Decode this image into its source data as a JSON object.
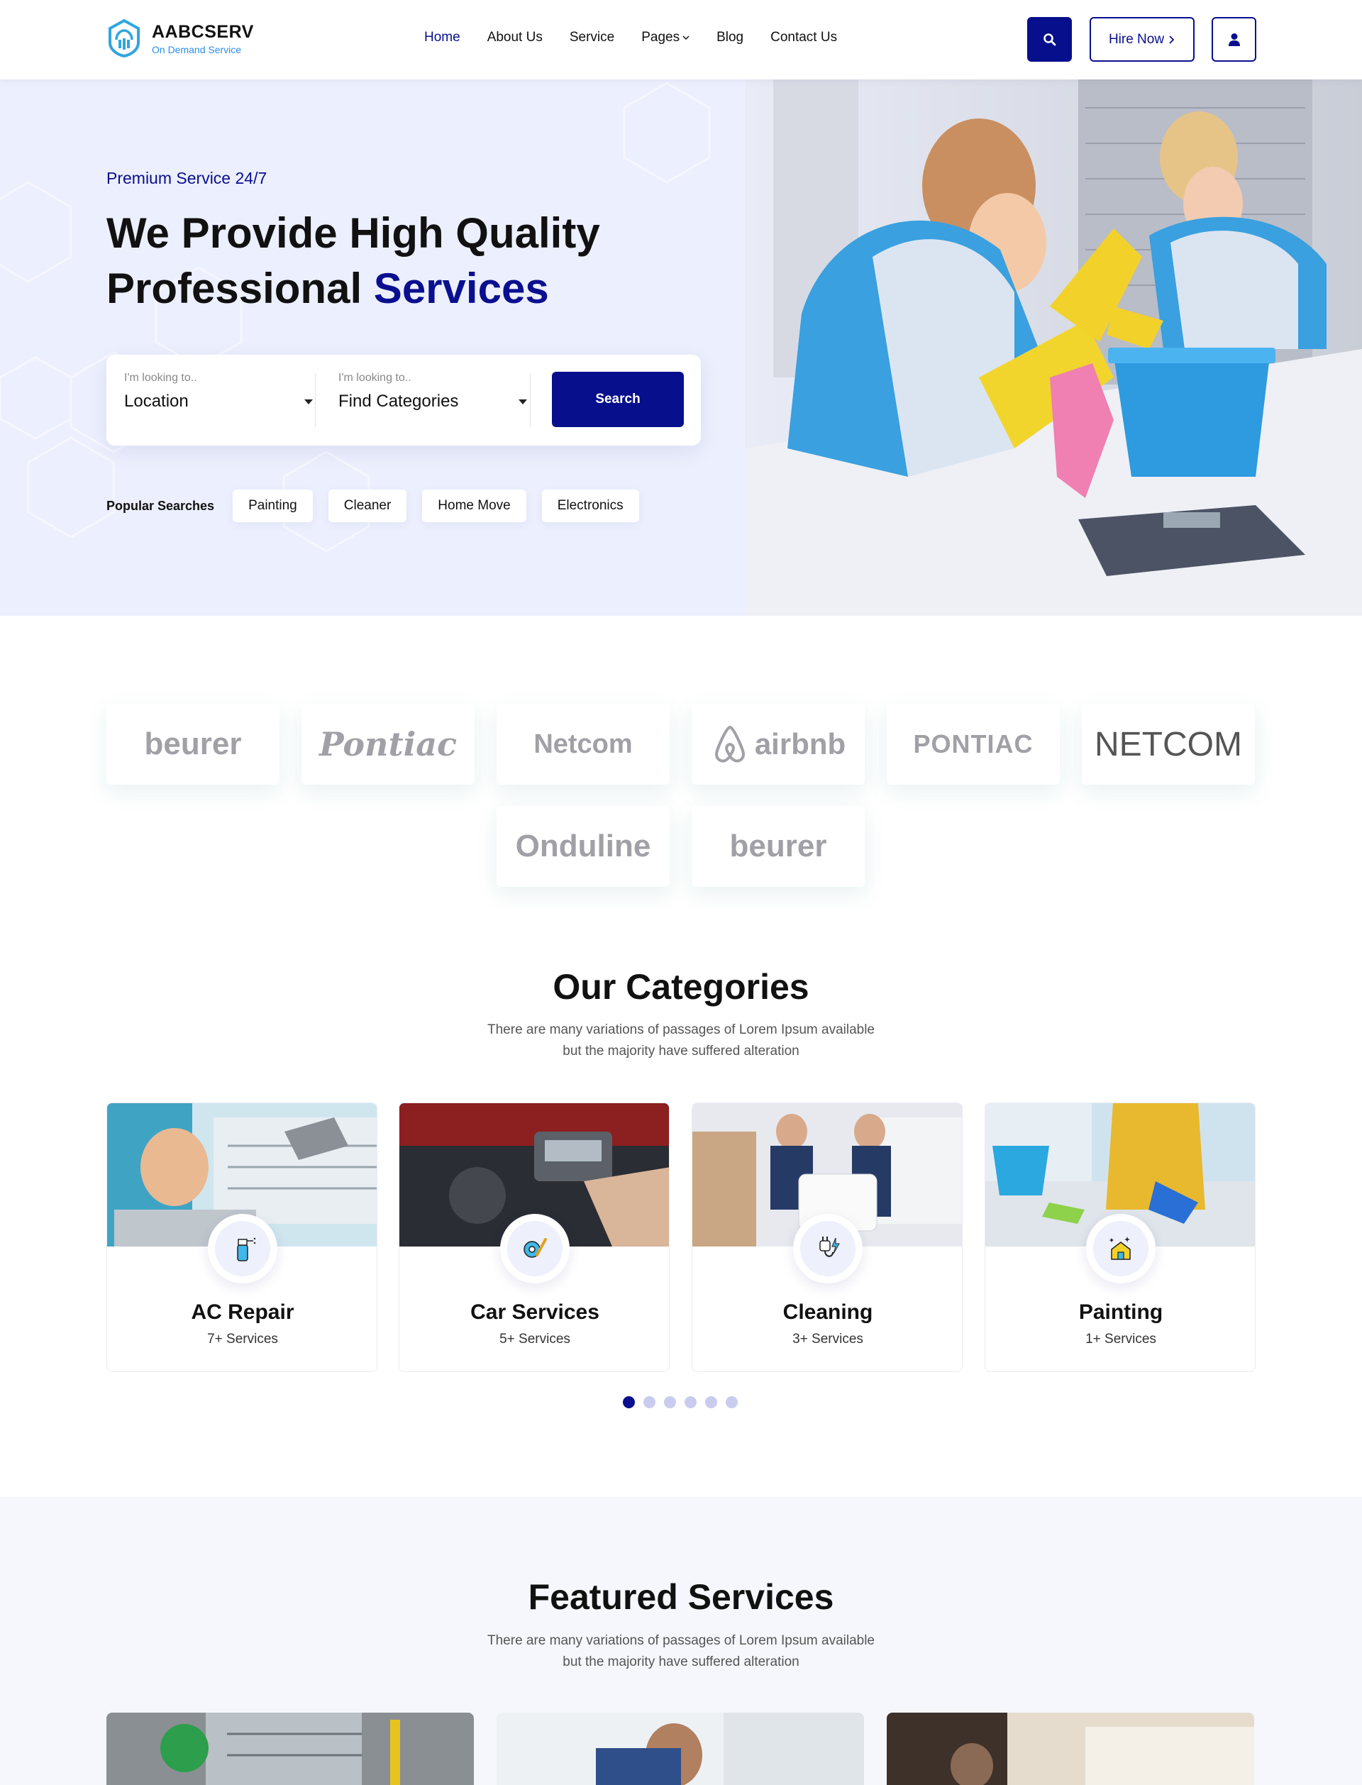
{
  "header": {
    "brand": "AABCSERV",
    "tagline": "On Demand Service",
    "nav": [
      {
        "label": "Home",
        "active": true
      },
      {
        "label": "About Us"
      },
      {
        "label": "Service"
      },
      {
        "label": "Pages",
        "dropdown": true
      },
      {
        "label": "Blog"
      },
      {
        "label": "Contact Us"
      }
    ],
    "hire_label": "Hire Now",
    "icons": {
      "search": "search-icon",
      "user": "user-icon",
      "chevron": "chevron-right-icon"
    }
  },
  "hero": {
    "tag": "Premium Service 24/7",
    "title_line1": "We Provide High Quality",
    "title_line2_plain": "Professional",
    "title_line2_accent": "Services",
    "search": {
      "location_label": "I'm looking to..",
      "location_value": "Location",
      "category_label": "I'm looking to..",
      "category_value": "Find Categories",
      "button": "Search"
    },
    "popular_label": "Popular Searches",
    "popular": [
      "Painting",
      "Cleaner",
      "Home Move",
      "Electronics"
    ]
  },
  "brands": [
    "beurer",
    "Pontiac",
    "Netcom",
    "airbnb",
    "PONTIAC",
    "NETCOM",
    "Onduline",
    "beurer"
  ],
  "categories": {
    "title": "Our Categories",
    "subtitle_line1": "There are many variations of passages of Lorem Ipsum available",
    "subtitle_line2": "but the majority have suffered alteration",
    "items": [
      {
        "name": "AC Repair",
        "count": "7+ Services",
        "icon": "spray-bottle-icon"
      },
      {
        "name": "Car Services",
        "count": "5+ Services",
        "icon": "wrench-gear-icon"
      },
      {
        "name": "Cleaning",
        "count": "3+ Services",
        "icon": "plug-icon"
      },
      {
        "name": "Painting",
        "count": "1+ Services",
        "icon": "house-clean-icon"
      }
    ],
    "pager_count": 6,
    "pager_active": 0
  },
  "featured": {
    "title": "Featured Services",
    "subtitle_line1": "There are many variations of passages of Lorem Ipsum available",
    "subtitle_line2": "but the majority have suffered alteration"
  },
  "colors": {
    "primary": "#070f8c",
    "accent_blue": "#2b8fe6",
    "hero_bg": "#eceffd"
  }
}
